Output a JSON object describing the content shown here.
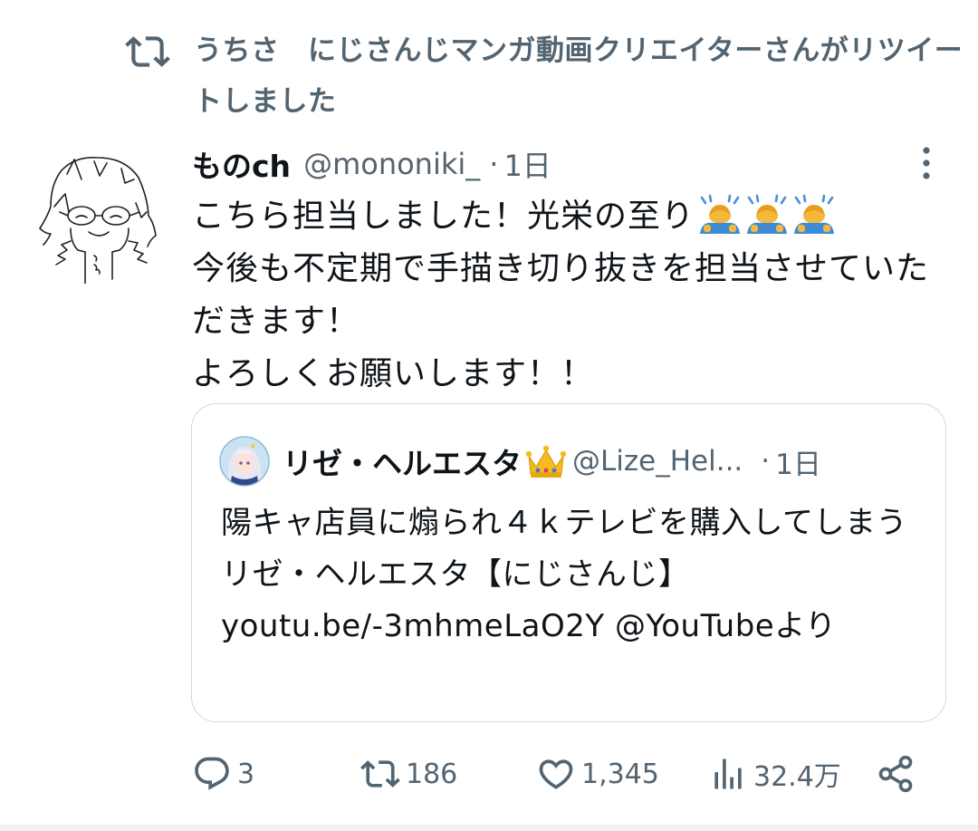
{
  "retweet_notice": "うちさ　にじさんじマンガ動画クリエイターさんがリツイートしました",
  "tweet": {
    "author_name": "ものch",
    "author_handle": "@mononiki_",
    "separator": "·",
    "time": "1日",
    "text_line1": "こちら担当しました！光栄の至り",
    "emojis": [
      "bowing-person",
      "bowing-person",
      "bowing-person"
    ],
    "text_line2": "今後も不定期で手描き切り抜きを担当させていただきます！",
    "text_line3": "よろしくお願いします！！"
  },
  "quoted_tweet": {
    "author_name": "リゼ・ヘルエスタ",
    "crown_icon": "crown-emoji",
    "author_handle": "@Lize_Hel...",
    "separator": "·",
    "time": "1日",
    "text": "陽キャ店員に煽られ４ｋテレビを購入してしまうリゼ・ヘルエスタ【にじさんじ】 youtu.be/-3mhmeLaO2Y @YouTubeより"
  },
  "actions": {
    "reply_count": "3",
    "retweet_count": "186",
    "like_count": "1,345",
    "view_count": "32.4万"
  },
  "colors": {
    "text_primary": "#0f1419",
    "text_secondary": "#536471",
    "border": "#cfd9de"
  }
}
